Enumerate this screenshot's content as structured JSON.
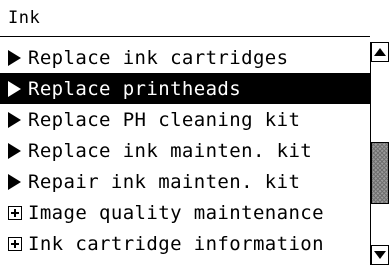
{
  "header": {
    "title": "Ink"
  },
  "menu": {
    "selected_index": 1,
    "items": [
      {
        "marker": "arrow",
        "label": "Replace ink cartridges"
      },
      {
        "marker": "arrow",
        "label": "Replace printheads"
      },
      {
        "marker": "arrow",
        "label": "Replace PH cleaning kit"
      },
      {
        "marker": "arrow",
        "label": "Replace ink mainten. kit"
      },
      {
        "marker": "arrow",
        "label": "Repair ink mainten. kit"
      },
      {
        "marker": "expand-box",
        "label": "Image quality maintenance"
      },
      {
        "marker": "expand-box",
        "label": "Ink cartridge information"
      }
    ]
  },
  "scrollbar": {
    "position_fraction": 0.66,
    "visible_fraction": 0.34,
    "up_icon": "scroll-up-arrow-icon",
    "down_icon": "scroll-down-arrow-icon"
  },
  "colors": {
    "background": "#ffffff",
    "foreground": "#000000",
    "selection_bg": "#000000",
    "selection_fg": "#ffffff",
    "thumb": "#9a9a9a"
  }
}
